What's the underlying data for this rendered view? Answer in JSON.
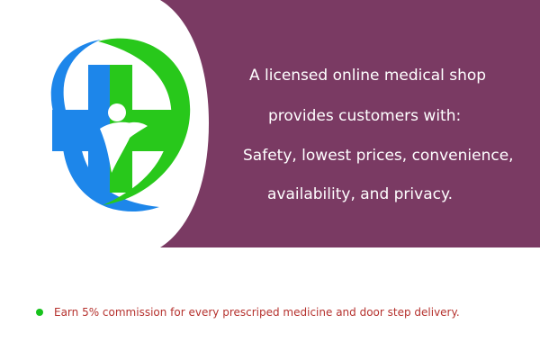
{
  "colors": {
    "banner_bg": "#7a3a63",
    "text_light": "#ffffff",
    "logo_blue": "#1d86ea",
    "logo_green": "#28c81b",
    "note_text": "#b5312d",
    "bullet_green": "#17c21c"
  },
  "banner": {
    "lines": [
      "A licensed online medical shop",
      "provides customers with:",
      "Safety, lowest prices, convenience,",
      "availability, and privacy."
    ]
  },
  "note": {
    "text": "Earn 5% commission for every prescriped medicine and door step delivery."
  },
  "icons": {
    "logo": "medical-cross-logo-icon",
    "bullet": "bullet-dot-icon"
  }
}
